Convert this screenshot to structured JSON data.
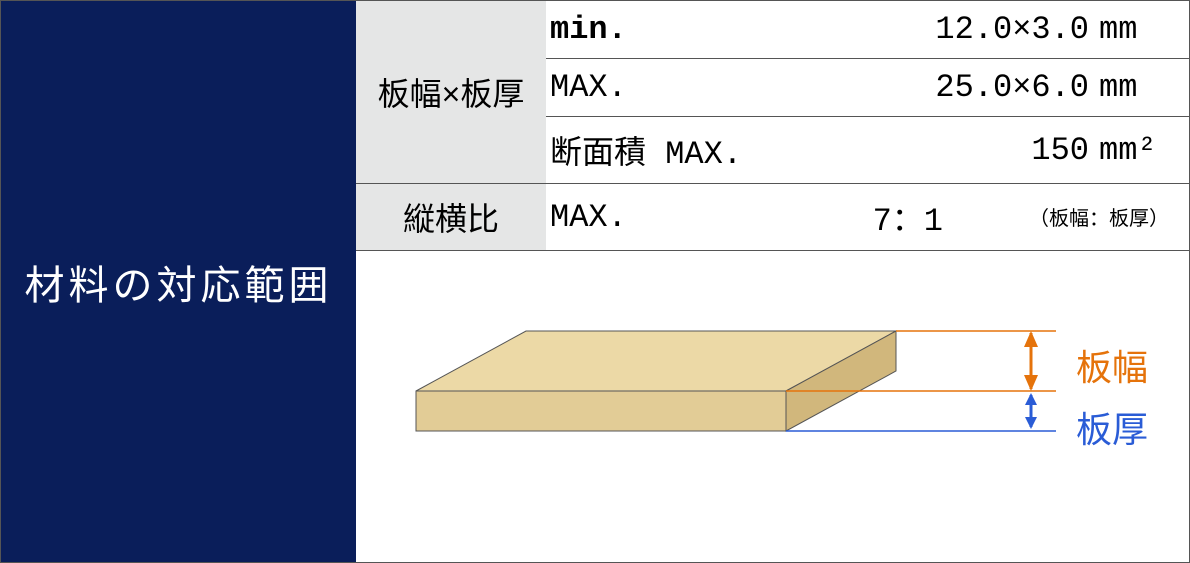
{
  "title": "材料の対応範囲",
  "rows": {
    "dim_label": "板幅×板厚",
    "min": {
      "key": "min.",
      "value": "12.0×3.0",
      "unit": "mm"
    },
    "max": {
      "key": "MAX.",
      "value": "25.0×6.0",
      "unit": "mm"
    },
    "area": {
      "key": "断面積 MAX.",
      "value": "150",
      "unit": "mm²"
    },
    "ratio_label": "縦横比",
    "ratio": {
      "key": "MAX.",
      "value": "7：1",
      "note": "（板幅：板厚）"
    }
  },
  "diagram": {
    "width_label": "板幅",
    "thickness_label": "板厚"
  },
  "colors": {
    "navy": "#0a1e5a",
    "grey": "#e5e6e6",
    "orange": "#e5730b",
    "blue": "#2a5cd6",
    "slab_top": "#ecd9a6",
    "slab_side": "#d1b77c",
    "slab_front": "#e2cc96"
  }
}
